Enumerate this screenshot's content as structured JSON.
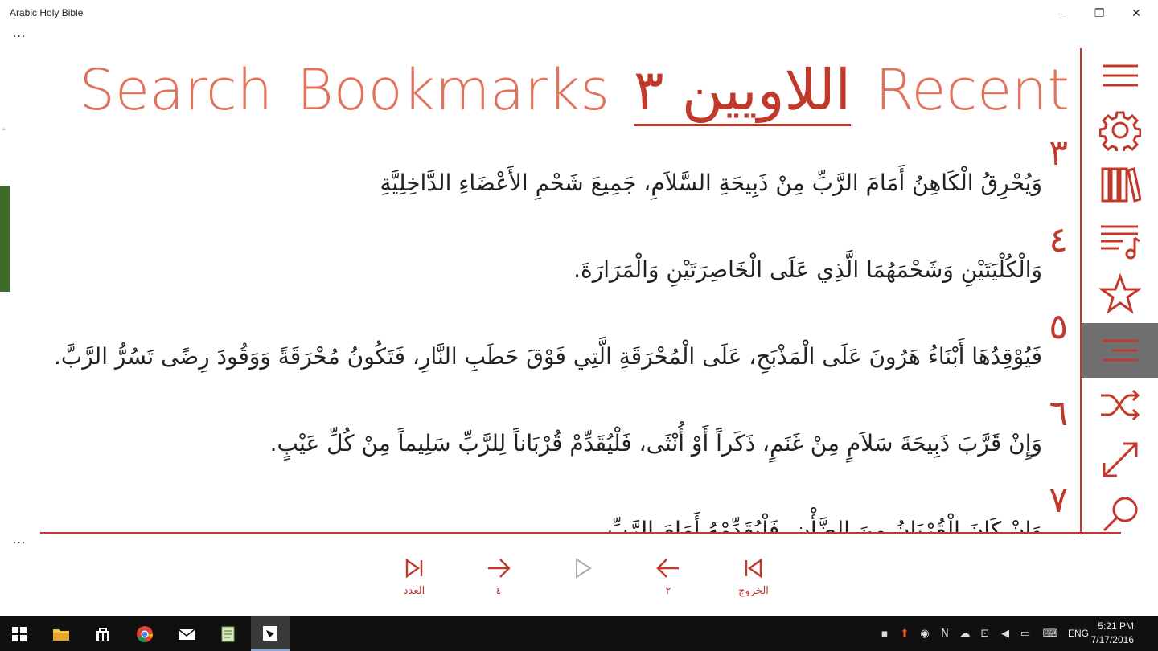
{
  "window": {
    "title": "Arabic Holy Bible",
    "minimize_glyph": "—",
    "maximize_glyph": "❐",
    "close_glyph": "✕"
  },
  "ellipsis_top": "...",
  "ellipsis_bottom": "...",
  "collapse_caret": "˄",
  "header": {
    "items": [
      {
        "label": "Search"
      },
      {
        "label": "Bookmarks"
      },
      {
        "label": "اللاويين ٣"
      },
      {
        "label": "Recent"
      }
    ],
    "active_index": 2
  },
  "verses": [
    {
      "num": "٣",
      "text": "وَيُحْرِقُ الْكَاهِنُ أَمَامَ الرَّبِّ مِنْ ذَبِيحَةِ السَّلاَمِ، جَمِيعَ شَحْمِ الأَعْضَاءِ الدَّاخِلِيَّةِ"
    },
    {
      "num": "٤",
      "text": "وَالْكُلْيَتَيْنِ وَشَحْمَهُمَا الَّذِي عَلَى الْخَاصِرَتَيْنِ وَالْمَرَارَةَ."
    },
    {
      "num": "٥",
      "text": "فَيُوْقِدُهَا أَبْنَاءُ هَرُونَ عَلَى الْمَذْبَحِ، عَلَى الْمُحْرَقَةِ الَّتِي فَوْقَ حَطَبِ النَّارِ، فَتَكُونُ مُحْرَقَةً وَوَقُودَ رِضًى تَسُرُّ الرَّبَّ."
    },
    {
      "num": "٦",
      "text": "وَإِنْ قَرَّبَ ذَبِيحَةَ سَلاَمٍ مِنْ غَنَمٍ، ذَكَراً أَوْ أُنْثَى، فَلْيُقَدِّمْ قُرْبَاناً لِلرَّبِّ سَلِيماً مِنْ كُلِّ عَيْبٍ."
    },
    {
      "num": "٧",
      "text": "وَإِنْ كَانَ الْقُرْبَانُ مِنَ الضَّأْنِ، فَلْيُقَدِّمْهُ أَمَامَ الرَّبِّ"
    }
  ],
  "sidebar": {
    "items": [
      {
        "icon": "hamburger-menu-icon"
      },
      {
        "icon": "gear-icon"
      },
      {
        "icon": "library-books-icon"
      },
      {
        "icon": "playlist-music-icon"
      },
      {
        "icon": "star-icon"
      },
      {
        "icon": "align-right-text-icon",
        "selected": true
      },
      {
        "icon": "shuffle-icon"
      },
      {
        "icon": "expand-arrows-icon"
      },
      {
        "icon": "magnifier-search-icon"
      }
    ]
  },
  "bottom_bar": {
    "last_label": "العدد",
    "next_label": "٤",
    "play_label": "",
    "prev_label": "٢",
    "first_label": "الخروج"
  },
  "taskbar": {
    "language": "ENG",
    "time": "5:21 PM",
    "date": "7/17/2016"
  },
  "colors": {
    "accent": "#c0392b",
    "accent_light": "#e0735a",
    "selected_bg": "#707070",
    "green_strip": "#3f6b2a",
    "taskbar_bg": "#101010"
  }
}
